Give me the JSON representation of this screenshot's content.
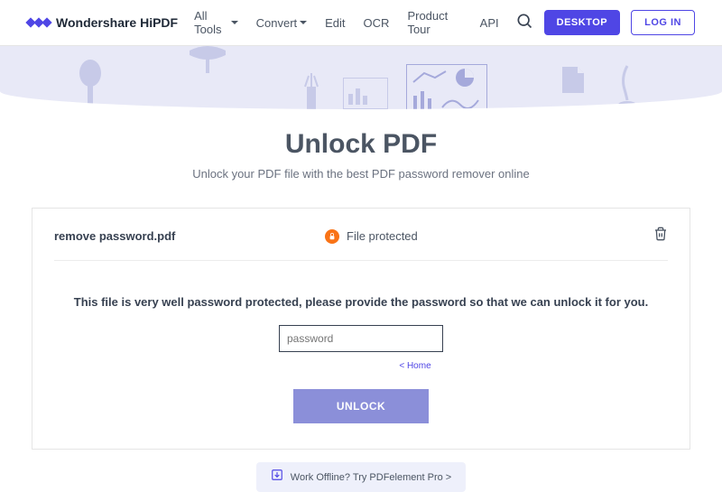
{
  "header": {
    "brand": "Wondershare HiPDF",
    "nav": {
      "all_tools": "All Tools",
      "convert": "Convert",
      "edit": "Edit",
      "ocr": "OCR",
      "product_tour": "Product Tour",
      "api": "API"
    },
    "desktop_btn": "DESKTOP",
    "login_btn": "LOG IN"
  },
  "page": {
    "title": "Unlock PDF",
    "subtitle": "Unlock your PDF file with the best PDF password remover online"
  },
  "file": {
    "name": "remove password.pdf",
    "status": "File protected"
  },
  "form": {
    "instruction": "This file is very well password protected, please provide the password so that we can unlock it for you.",
    "password_placeholder": "password",
    "home_link": "< Home",
    "unlock_btn": "UNLOCK"
  },
  "footer": {
    "offline_text": "Work Offline? Try PDFelement Pro >"
  }
}
